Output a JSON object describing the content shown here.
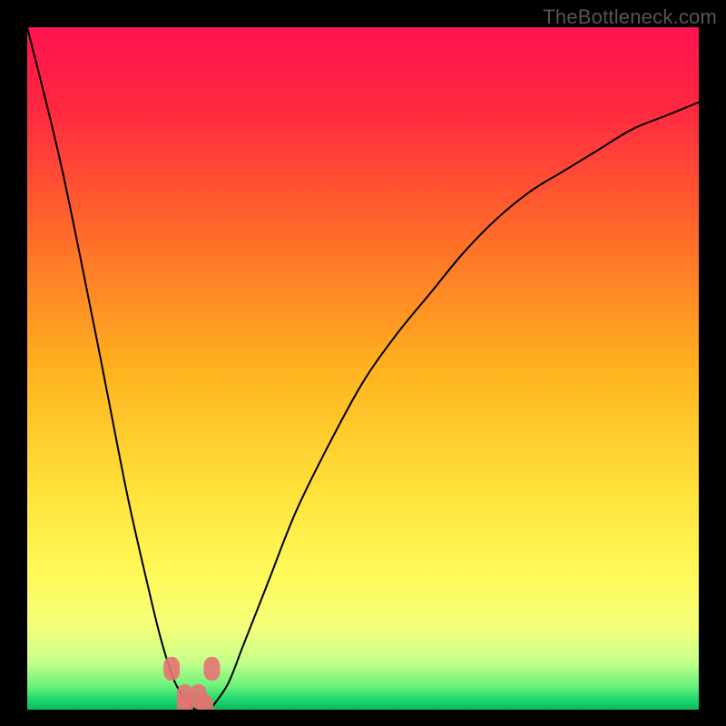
{
  "watermark": "TheBottleneck.com",
  "chart_data": {
    "type": "line",
    "title": "",
    "xlabel": "",
    "ylabel": "",
    "xlim": [
      0,
      1
    ],
    "ylim": [
      0,
      1
    ],
    "x": [
      0.0,
      0.05,
      0.1,
      0.12,
      0.15,
      0.18,
      0.2,
      0.22,
      0.24,
      0.25,
      0.26,
      0.27,
      0.28,
      0.3,
      0.32,
      0.34,
      0.36,
      0.4,
      0.45,
      0.5,
      0.55,
      0.6,
      0.65,
      0.7,
      0.75,
      0.8,
      0.85,
      0.9,
      0.95,
      1.0
    ],
    "y": [
      1.0,
      0.8,
      0.56,
      0.46,
      0.31,
      0.18,
      0.1,
      0.04,
      0.01,
      0.0,
      0.0,
      0.0,
      0.01,
      0.04,
      0.09,
      0.14,
      0.19,
      0.29,
      0.39,
      0.48,
      0.55,
      0.61,
      0.67,
      0.72,
      0.76,
      0.79,
      0.82,
      0.85,
      0.87,
      0.89
    ],
    "markers": {
      "x": [
        0.215,
        0.235,
        0.255,
        0.275,
        0.235,
        0.265
      ],
      "y": [
        0.06,
        0.02,
        0.02,
        0.06,
        0.005,
        0.005
      ]
    },
    "gradient_stops": [
      {
        "offset": 0.0,
        "color": "#ff1350"
      },
      {
        "offset": 0.12,
        "color": "#ff2840"
      },
      {
        "offset": 0.3,
        "color": "#ff6a2a"
      },
      {
        "offset": 0.5,
        "color": "#ffb21f"
      },
      {
        "offset": 0.68,
        "color": "#ffe23a"
      },
      {
        "offset": 0.8,
        "color": "#fff95a"
      },
      {
        "offset": 0.88,
        "color": "#f4ff7a"
      },
      {
        "offset": 0.93,
        "color": "#c6ff8a"
      },
      {
        "offset": 0.965,
        "color": "#6cf27b"
      },
      {
        "offset": 0.985,
        "color": "#1fd86f"
      },
      {
        "offset": 1.0,
        "color": "#0fb85f"
      }
    ]
  }
}
